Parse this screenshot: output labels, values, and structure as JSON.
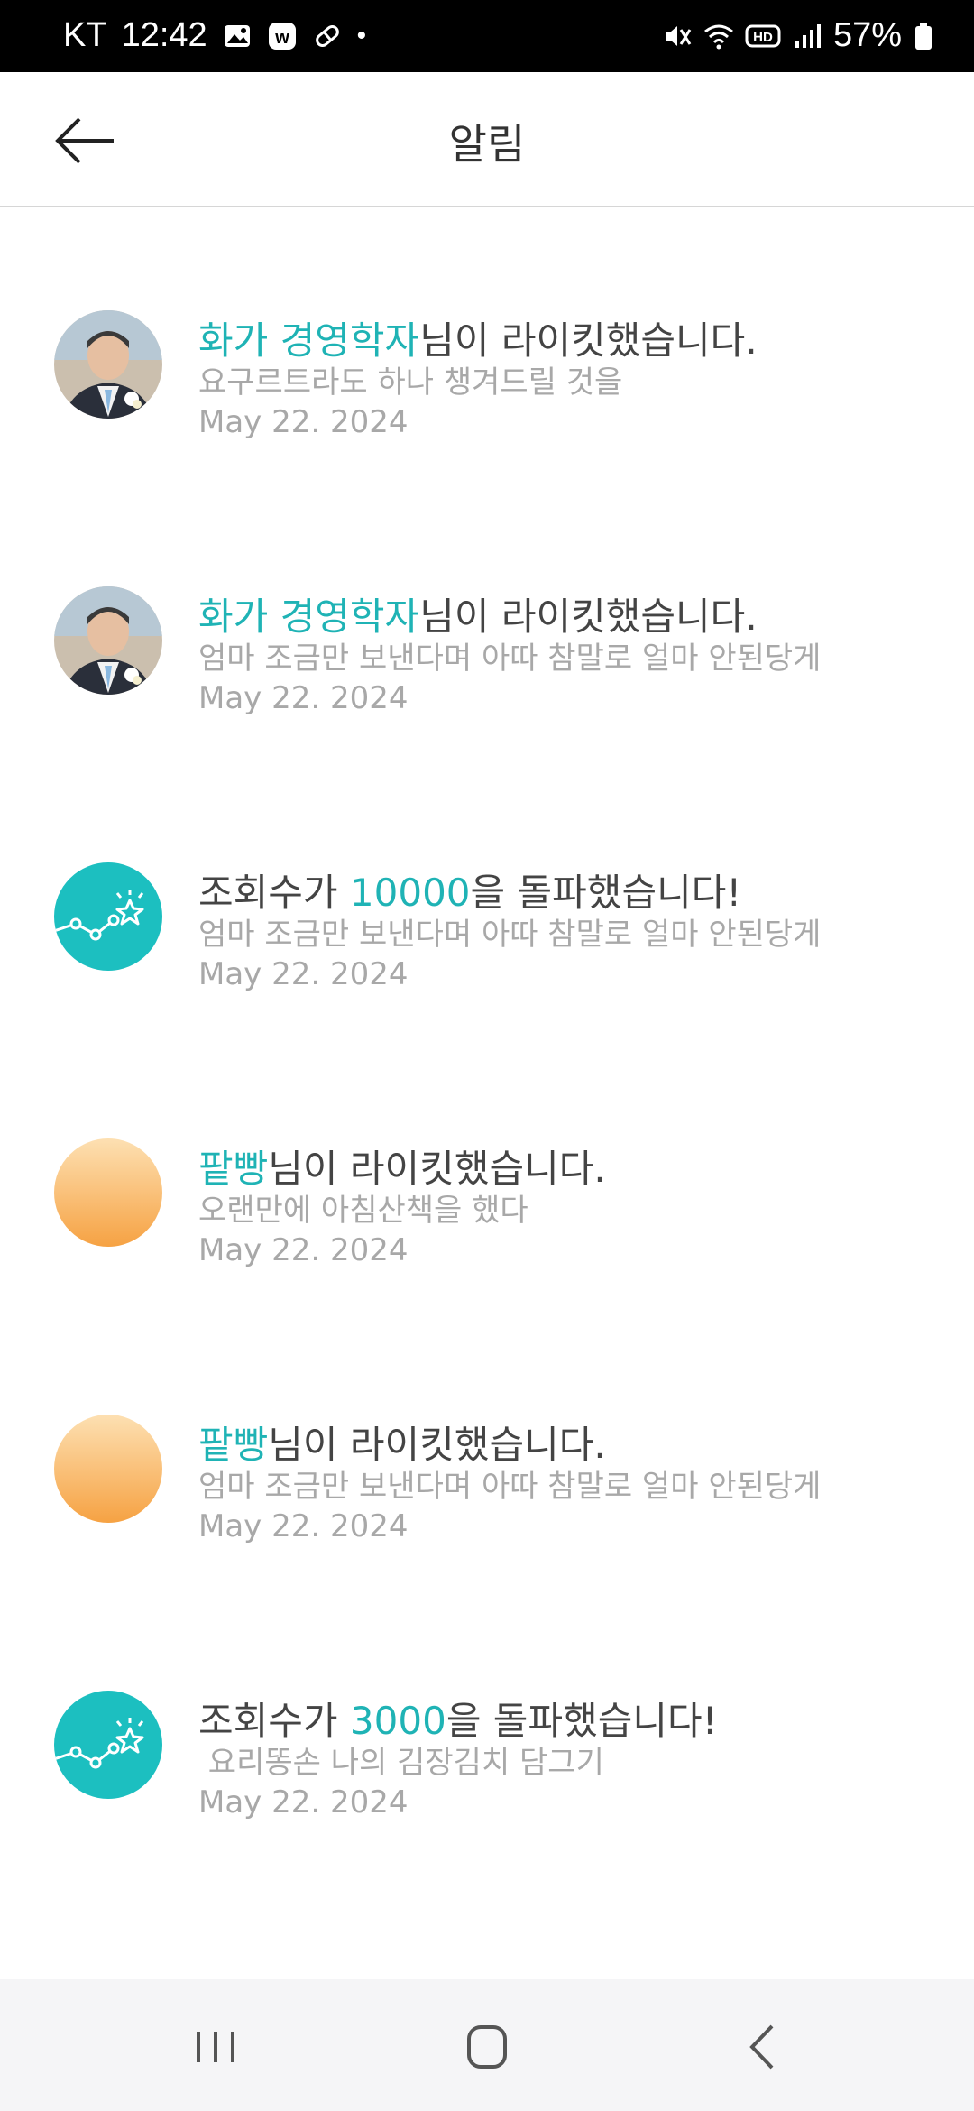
{
  "status_bar": {
    "carrier": "KT",
    "time": "12:42",
    "battery": "57%"
  },
  "header": {
    "title": "알림",
    "back_icon": "arrow-left-icon"
  },
  "notifications": [
    {
      "avatar": "profile-photo",
      "actor": "화가 경영학자",
      "action": "님이 라이킷했습니다.",
      "subtitle": "요구르트라도 하나 챙겨드릴 것을",
      "date": "May 22. 2024"
    },
    {
      "avatar": "profile-photo",
      "actor": "화가 경영학자",
      "action": "님이 라이킷했습니다.",
      "subtitle": "엄마 조금만 보낸다며 아따 참말로 얼마 안된당게",
      "date": "May 22. 2024"
    },
    {
      "avatar": "views-milestone",
      "prefix": "조회수가 ",
      "count": "10000",
      "suffix": "을 돌파했습니다!",
      "subtitle": "엄마 조금만 보낸다며 아따 참말로 얼마 안된당게",
      "date": "May 22. 2024"
    },
    {
      "avatar": "orange-circle",
      "actor": "팥빵",
      "action": "님이 라이킷했습니다.",
      "subtitle": "오랜만에 아침산책을 했다",
      "date": "May 22. 2024"
    },
    {
      "avatar": "orange-circle",
      "actor": "팥빵",
      "action": "님이 라이킷했습니다.",
      "subtitle": "엄마 조금만 보낸다며 아따 참말로 얼마 안된당게",
      "date": "May 22. 2024"
    },
    {
      "avatar": "views-milestone",
      "prefix": "조회수가 ",
      "count": "3000",
      "suffix": "을 돌파했습니다!",
      "subtitle": " 요리똥손 나의 김장김치 담그기",
      "date": "May 22. 2024"
    }
  ],
  "colors": {
    "accent": "#1fb3b5",
    "avatar_teal": "#1cbfc0",
    "avatar_orange": "#f6a243"
  },
  "nav_bar": {
    "icons": [
      "recents-icon",
      "home-icon",
      "back-icon"
    ]
  }
}
